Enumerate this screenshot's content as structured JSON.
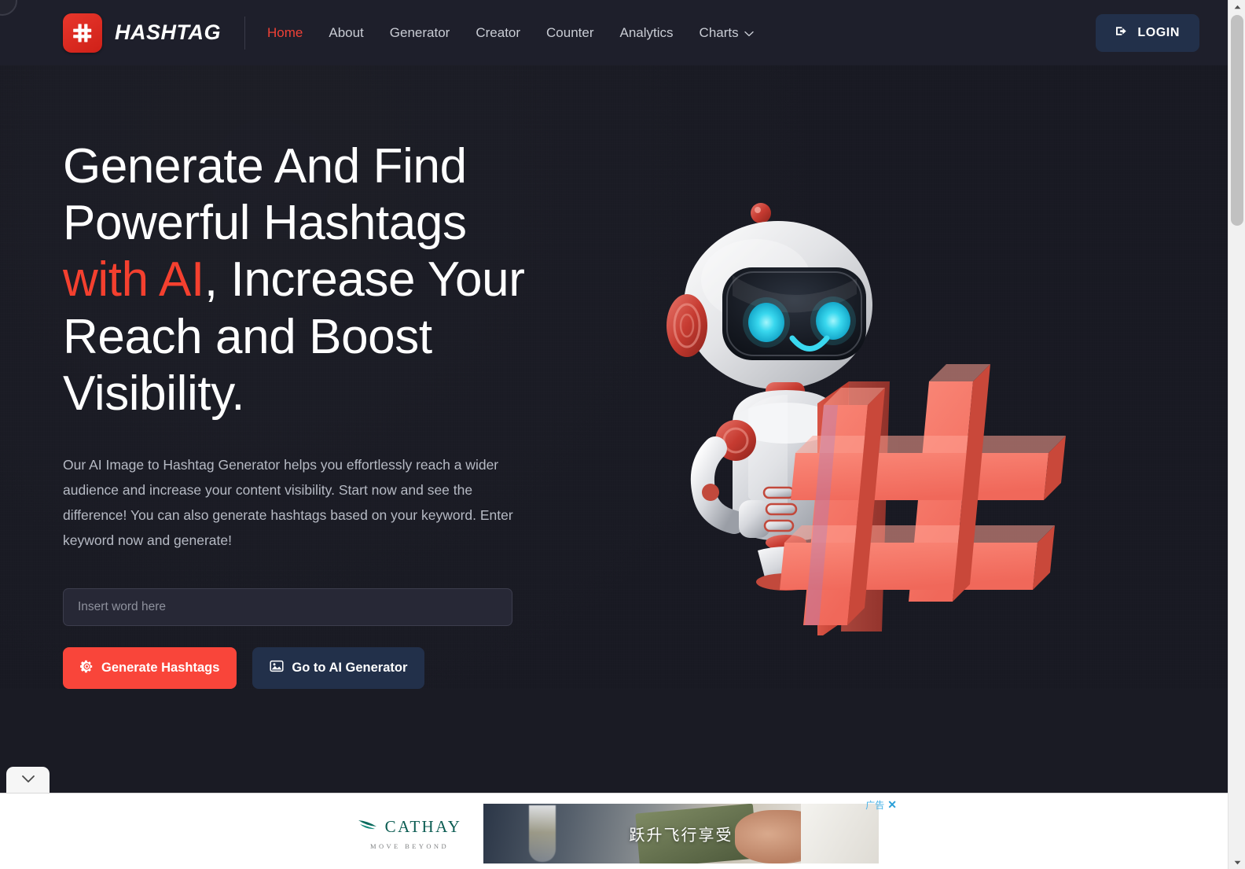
{
  "brand": {
    "name": "HASHTAG",
    "logo_icon": "hashtag-logo-icon",
    "accent_color": "#ef4136"
  },
  "nav": {
    "items": [
      {
        "label": "Home",
        "active": true
      },
      {
        "label": "About",
        "active": false
      },
      {
        "label": "Generator",
        "active": false
      },
      {
        "label": "Creator",
        "active": false
      },
      {
        "label": "Counter",
        "active": false
      },
      {
        "label": "Analytics",
        "active": false
      },
      {
        "label": "Charts",
        "active": false,
        "has_dropdown": true
      }
    ],
    "login_label": "LOGIN",
    "login_icon": "sign-in-icon"
  },
  "hero": {
    "title_line1": "Generate And Find",
    "title_line2": "Powerful Hashtags",
    "title_accent": "with AI",
    "title_line3_rest": ", Increase Your",
    "title_line4": "Reach and Boost",
    "title_line5": "Visibility.",
    "paragraph": "Our AI Image to Hashtag Generator helps you effortlessly reach a wider audience and increase your content visibility. Start now and see the difference! You can also generate hashtags based on your keyword. Enter keyword now and generate!",
    "input_placeholder": "Insert word here",
    "input_value": "",
    "primary_button": "Generate Hashtags",
    "primary_button_icon": "gear-icon",
    "secondary_button": "Go to AI Generator",
    "secondary_button_icon": "image-icon",
    "art_alt": "robot-holding-hashtag-illustration"
  },
  "ad": {
    "brand_name": "CATHAY",
    "tagline": "MOVE BEYOND",
    "headline": "跃升飞行享受",
    "label": "广告",
    "close": "✕",
    "brand_color": "#0b5c52"
  },
  "chrome": {
    "collapse_icon": "chevron-down-icon",
    "scroll_up_icon": "scroll-up-arrow-icon",
    "scroll_down_icon": "scroll-down-arrow-icon"
  }
}
